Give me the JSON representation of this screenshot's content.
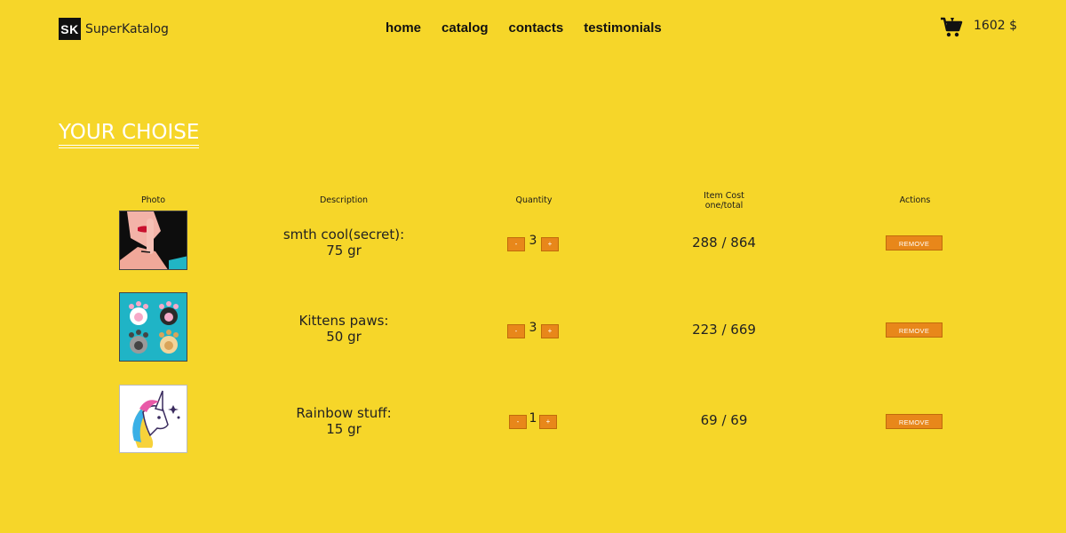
{
  "brand": {
    "mark": "SK",
    "name": "SuperKatalog"
  },
  "nav": [
    "home",
    "catalog",
    "contacts",
    "testimonials"
  ],
  "cart": {
    "icon": "cart-icon",
    "total": "1602 $"
  },
  "section_title": "YOUR CHOISE",
  "table": {
    "headers": {
      "photo": "Photo",
      "description": "Description",
      "quantity": "Quantity",
      "cost_line1": "Item Cost",
      "cost_line2": "one/total",
      "actions": "Actions"
    },
    "rows": [
      {
        "photo": "secret-girl-image",
        "name": "smth cool(secret):",
        "weight": "75 gr",
        "minus": "-",
        "qty": "3",
        "plus": "+",
        "cost": "288 / 864",
        "action": "REMOVE"
      },
      {
        "photo": "kitten-paws-image",
        "name": "Kittens paws:",
        "weight": "50 gr",
        "minus": "-",
        "qty": "3",
        "plus": "+",
        "cost": "223 / 669",
        "action": "REMOVE"
      },
      {
        "photo": "unicorn-image",
        "name": "Rainbow stuff:",
        "weight": "15 gr",
        "minus": "-",
        "qty": "1",
        "plus": "+",
        "cost": "69 / 69",
        "action": "REMOVE"
      }
    ]
  },
  "colors": {
    "background": "#f6d629",
    "button": "#e8871a",
    "heading": "#ffffff"
  }
}
